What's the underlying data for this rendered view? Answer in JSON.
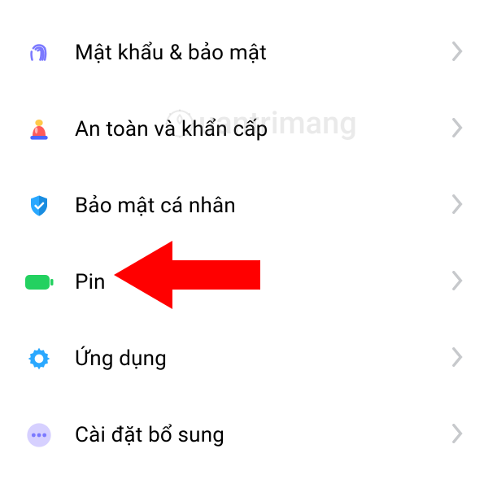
{
  "items": [
    {
      "label": "Mật khẩu & bảo mật"
    },
    {
      "label": "An toàn và khẩn cấp"
    },
    {
      "label": "Bảo mật cá nhân"
    },
    {
      "label": "Pin"
    },
    {
      "label": "Ứng dụng"
    },
    {
      "label": "Cài đặt bổ sung"
    }
  ],
  "watermark": "uantrimang",
  "colors": {
    "fingerprint": "#7b79ff",
    "siren_body": "#ff5a5a",
    "siren_light": "#ffc94a",
    "siren_base": "#4b64ff",
    "shield": "#2aa8ff",
    "battery": "#23d160",
    "gear": "#2aa8ff",
    "ellipsis_bg": "#d6d0ff",
    "ellipsis_dot": "#7b79ff",
    "chevron": "#c7c9cc",
    "arrow": "#ff0000"
  }
}
